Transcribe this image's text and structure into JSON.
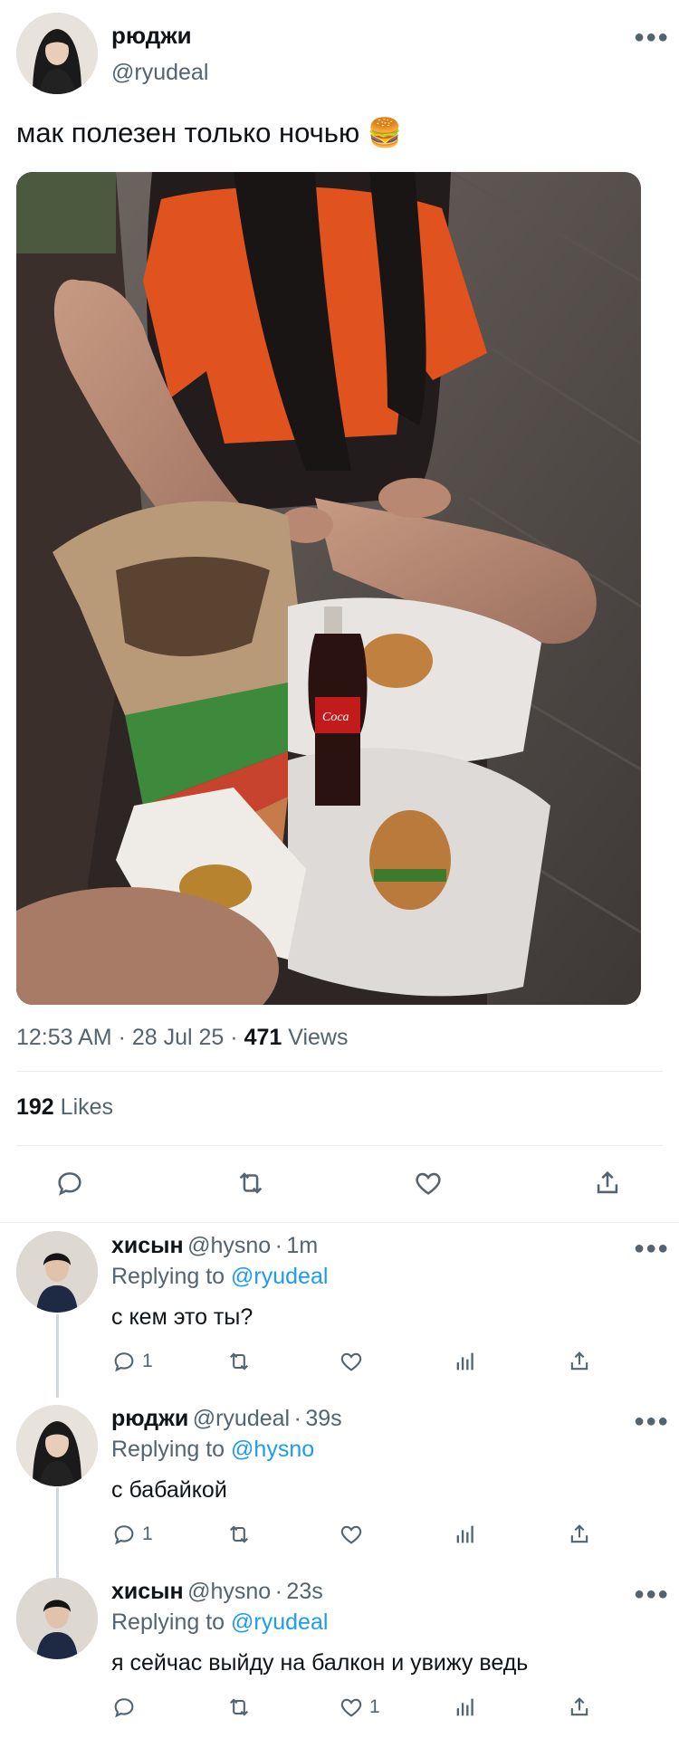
{
  "main_tweet": {
    "display_name": "рюджи",
    "handle": "@ryudeal",
    "text": "мак полезен только ночью 🍔",
    "time": "12:53 AM",
    "date": "28 Jul 25",
    "views_count": "471",
    "views_label": "Views",
    "likes_count": "192",
    "likes_label": "Likes",
    "separator": "·"
  },
  "replies": [
    {
      "display_name": "хисын",
      "handle": "@hysno",
      "age": "1m",
      "replying_label": "Replying to",
      "replying_to": "@ryudeal",
      "text": "с кем это ты?",
      "reply_count": "1",
      "like_count": ""
    },
    {
      "display_name": "рюджи",
      "handle": "@ryudeal",
      "age": "39s",
      "replying_label": "Replying to",
      "replying_to": "@hysno",
      "text": "с бабайкой",
      "reply_count": "1",
      "like_count": ""
    },
    {
      "display_name": "хисын",
      "handle": "@hysno",
      "age": "23s",
      "replying_label": "Replying to",
      "replying_to": "@ryudeal",
      "text": "я сейчас выйду на балкон и увижу ведь",
      "reply_count": "",
      "like_count": "1"
    }
  ],
  "colors": {
    "text": "#0f1419",
    "muted": "#536471",
    "link": "#1d9bf0",
    "divider": "#e6ecf0"
  },
  "icons": [
    "more-icon",
    "reply-icon",
    "retweet-icon",
    "like-icon",
    "share-icon",
    "analytics-icon"
  ]
}
